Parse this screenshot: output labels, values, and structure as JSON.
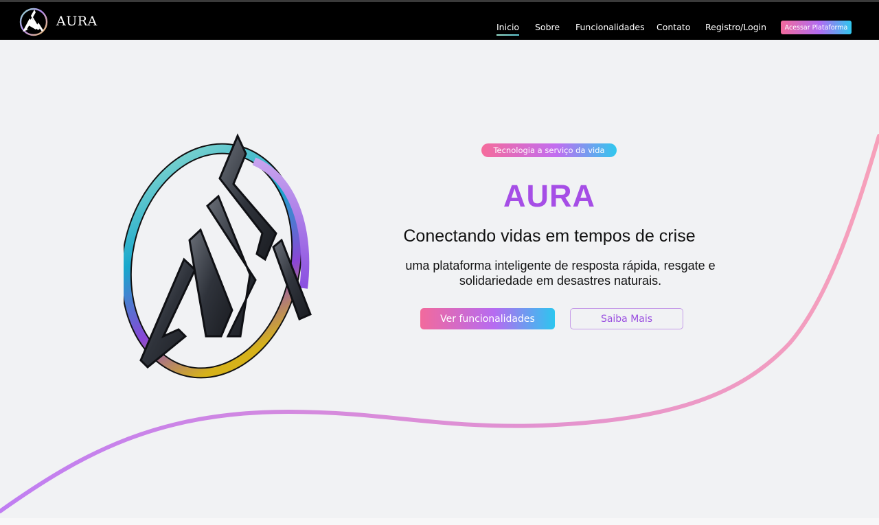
{
  "brand": {
    "name": "AURA",
    "logo_icon": "aura-logo-icon"
  },
  "nav": {
    "items": [
      {
        "label": "Inicio",
        "active": true
      },
      {
        "label": "Sobre",
        "active": false
      },
      {
        "label": "Funcionalidades",
        "active": false
      },
      {
        "label": "Contato",
        "active": false
      },
      {
        "label": "Registro/Login",
        "active": false
      }
    ],
    "cta_label": "Acessar Plataforma"
  },
  "hero": {
    "tag": "Tecnologia a serviço da vida",
    "title": "AURA",
    "subtitle": "Conectando vidas em tempos de crise",
    "description": "uma plataforma inteligente de resposta rápida, resgate e solidariedade em desastres naturais.",
    "primary_button": "Ver funcionalidades",
    "secondary_button": "Saiba Mais"
  },
  "colors": {
    "background": "#f1f2f4",
    "navbar": "#000000",
    "title_purple": "#a64ee6",
    "gradient_pink": "#f26a9c",
    "gradient_purple": "#b66bf1",
    "gradient_cyan": "#2dc6ef"
  }
}
